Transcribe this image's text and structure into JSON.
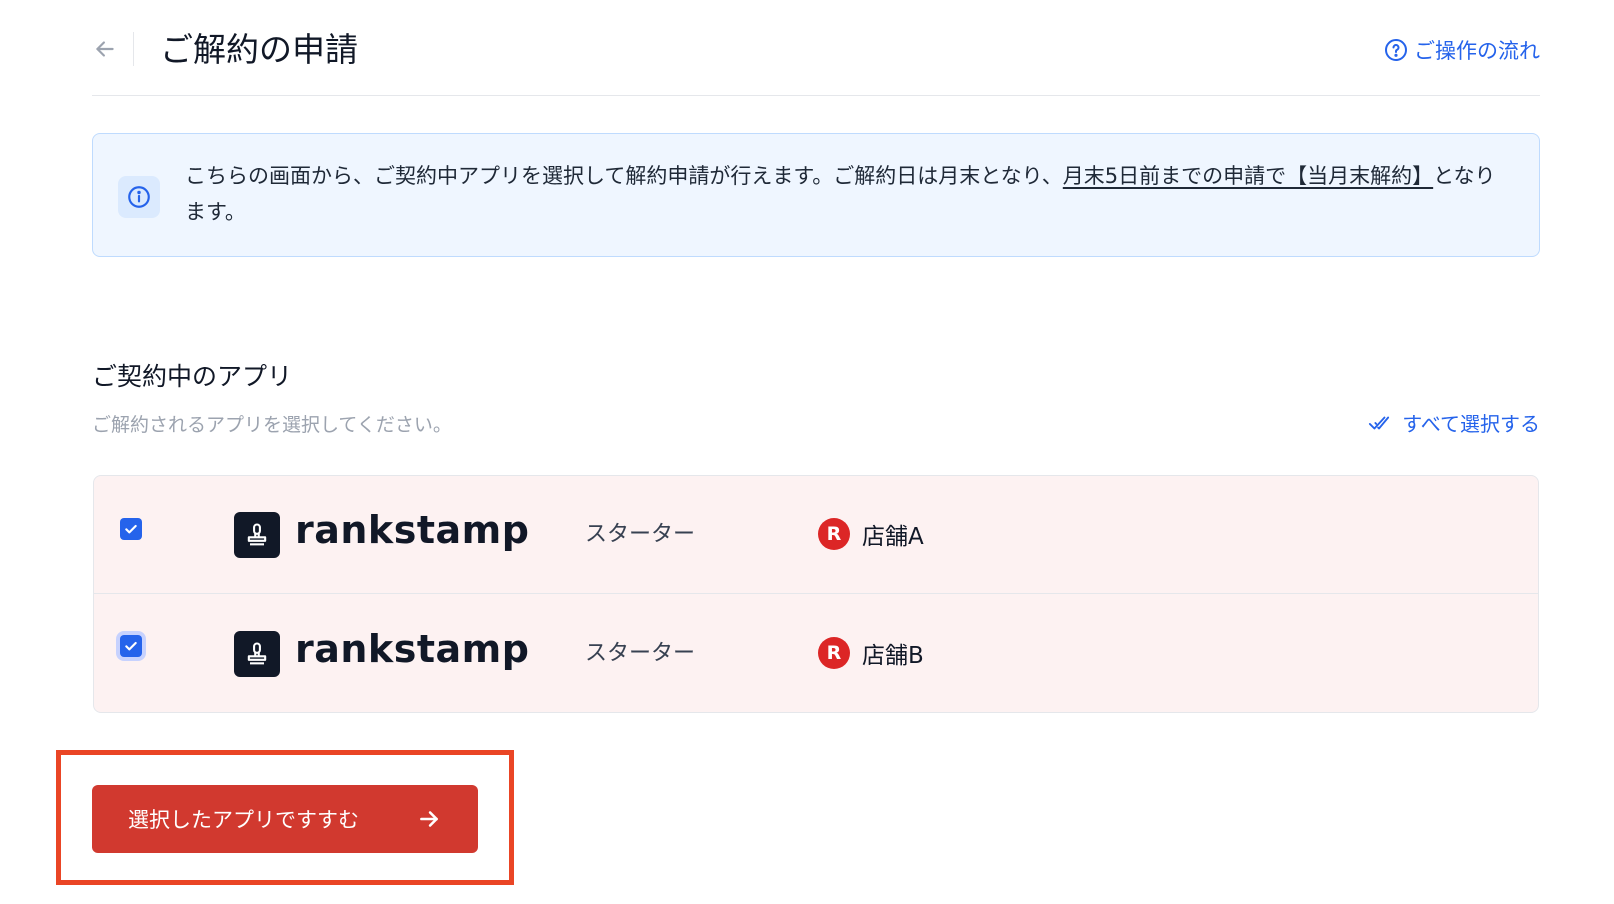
{
  "header": {
    "title": "ご解約の申請",
    "flow_link": "ご操作の流れ",
    "back_icon": "arrow-left-icon",
    "help_icon": "question-circle-icon"
  },
  "info": {
    "icon": "info-circle-icon",
    "text_before": "こちらの画面から、ご契約中アプリを選択して解約申請が行えます。ご解約日は月末となり、",
    "link_text": "月末5日前までの申請で【当月末解約】",
    "text_after": "となります。"
  },
  "section": {
    "title": "ご契約中のアプリ",
    "subtitle": "ご解約されるアプリを選択してください。",
    "select_all": "すべて選択する"
  },
  "apps": [
    {
      "logo": "rankstamp",
      "plan": "スターター",
      "store_badge": "R",
      "store": "店舗A",
      "checked": true
    },
    {
      "logo": "rankstamp",
      "plan": "スターター",
      "store_badge": "R",
      "store": "店舗B",
      "checked": true
    }
  ],
  "proceed_button": "選択したアプリですすむ",
  "colors": {
    "accent": "#2563eb",
    "primary_button": "#d1392f",
    "highlight": "#ea4525",
    "list_bg": "#fdf2f2"
  }
}
